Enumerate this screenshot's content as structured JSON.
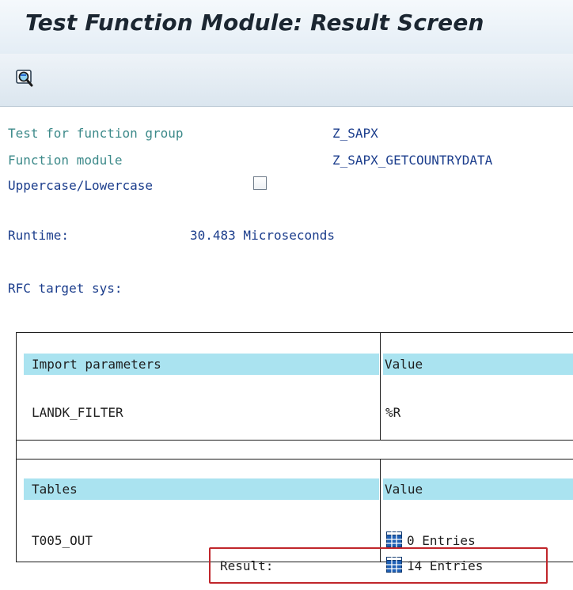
{
  "window": {
    "title": "Test Function Module: Result Screen"
  },
  "toolbar": {
    "button_icon": "magnifier-icon"
  },
  "info": {
    "function_group_label": "Test for function group",
    "function_group_value": "Z_SAPX",
    "function_module_label": "Function module",
    "function_module_value": "Z_SAPX_GETCOUNTRYDATA",
    "case_label": "Uppercase/Lowercase",
    "case_checked": false,
    "runtime_label": "Runtime:",
    "runtime_value": "30.483 Microseconds",
    "rfc_label": "RFC target sys:"
  },
  "import_table": {
    "col1_header": "Import parameters",
    "col2_header": "Value",
    "rows": [
      {
        "name": "LANDK_FILTER",
        "value": "%R"
      }
    ]
  },
  "tables_table": {
    "col1_header": "Tables",
    "col2_header": "Value",
    "rows": [
      {
        "name": "T005_OUT",
        "value": "0 Entries",
        "result_label": "Result:",
        "result_value": "14 Entries"
      }
    ]
  },
  "colors": {
    "header_bg": "#aae3f0",
    "highlight_border": "#c0262b",
    "label_teal": "#3d8a8a",
    "label_blue": "#1b3d8c"
  }
}
